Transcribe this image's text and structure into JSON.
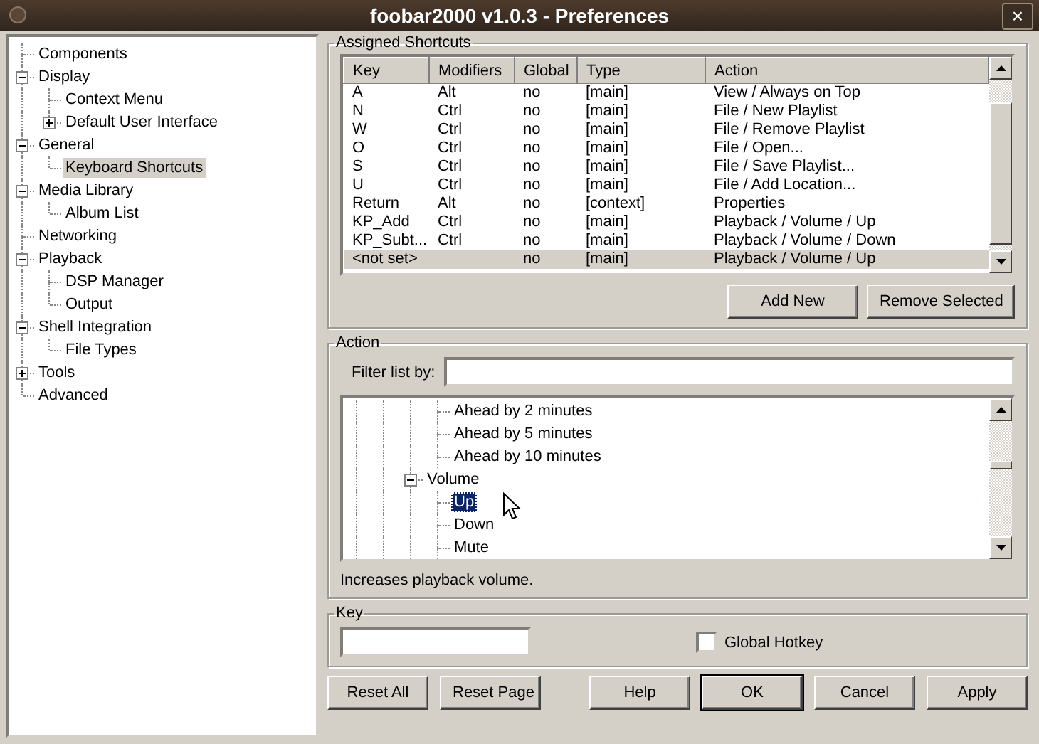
{
  "window": {
    "title": "foobar2000 v1.0.3 - Preferences",
    "close": "×"
  },
  "sidebar": {
    "items": [
      {
        "label": "Components",
        "selected": false
      },
      {
        "label": "Display",
        "selected": false,
        "expanded": true,
        "children": [
          {
            "label": "Context Menu",
            "selected": false
          },
          {
            "label": "Default User Interface",
            "selected": false,
            "expanded": false
          }
        ]
      },
      {
        "label": "General",
        "selected": false,
        "expanded": true,
        "children": [
          {
            "label": "Keyboard Shortcuts",
            "selected": true
          }
        ]
      },
      {
        "label": "Media Library",
        "selected": false,
        "expanded": true,
        "children": [
          {
            "label": "Album List",
            "selected": false
          }
        ]
      },
      {
        "label": "Networking",
        "selected": false
      },
      {
        "label": "Playback",
        "selected": false,
        "expanded": true,
        "children": [
          {
            "label": "DSP Manager",
            "selected": false
          },
          {
            "label": "Output",
            "selected": false
          }
        ]
      },
      {
        "label": "Shell Integration",
        "selected": false,
        "expanded": true,
        "children": [
          {
            "label": "File Types",
            "selected": false
          }
        ]
      },
      {
        "label": "Tools",
        "selected": false,
        "expanded": false
      },
      {
        "label": "Advanced",
        "selected": false
      }
    ]
  },
  "shortcuts": {
    "title": "Assigned Shortcuts",
    "columns": [
      "Key",
      "Modifiers",
      "Global",
      "Type",
      "Action"
    ],
    "rows": [
      {
        "cells": [
          "A",
          "Alt",
          "no",
          "[main]",
          "View / Always on Top"
        ],
        "selected": false
      },
      {
        "cells": [
          "N",
          "Ctrl",
          "no",
          "[main]",
          "File / New Playlist"
        ],
        "selected": false
      },
      {
        "cells": [
          "W",
          "Ctrl",
          "no",
          "[main]",
          "File / Remove Playlist"
        ],
        "selected": false
      },
      {
        "cells": [
          "O",
          "Ctrl",
          "no",
          "[main]",
          "File / Open..."
        ],
        "selected": false
      },
      {
        "cells": [
          "S",
          "Ctrl",
          "no",
          "[main]",
          "File / Save Playlist..."
        ],
        "selected": false
      },
      {
        "cells": [
          "U",
          "Ctrl",
          "no",
          "[main]",
          "File / Add Location..."
        ],
        "selected": false
      },
      {
        "cells": [
          "Return",
          "Alt",
          "no",
          "[context]",
          "Properties"
        ],
        "selected": false
      },
      {
        "cells": [
          "KP_Add",
          "Ctrl",
          "no",
          "[main]",
          "Playback / Volume / Up"
        ],
        "selected": false
      },
      {
        "cells": [
          "KP_Subt...",
          "Ctrl",
          "no",
          "[main]",
          "Playback / Volume / Down"
        ],
        "selected": false
      },
      {
        "cells": [
          "<not set>",
          "",
          "no",
          "[main]",
          "Playback / Volume / Up"
        ],
        "selected": true
      }
    ],
    "buttons": [
      "Add New",
      "Remove Selected"
    ]
  },
  "action": {
    "title": "Action",
    "filter_label": "Filter list by:",
    "tree": [
      {
        "children": [
          {
            "children": [
              {
                "children": [
                  {
                    "label": "Ahead by 2 minutes",
                    "selected": false
                  },
                  {
                    "label": "Ahead by 5 minutes",
                    "selected": false
                  },
                  {
                    "label": "Ahead by 10 minutes",
                    "selected": false
                  }
                ]
              },
              {
                "label": "Volume",
                "selected": false,
                "expanded": true,
                "children": [
                  {
                    "label": "Up",
                    "selected": true
                  },
                  {
                    "label": "Down",
                    "selected": false
                  },
                  {
                    "label": "Mute",
                    "selected": false
                  }
                ]
              }
            ]
          }
        ]
      }
    ],
    "description": "Increases playback volume."
  },
  "key": {
    "title": "Key",
    "global_hotkey": {
      "label": "Global Hotkey",
      "checked": false
    }
  },
  "buttons": [
    {
      "label": "Reset All",
      "default": false
    },
    {
      "label": "Reset Page",
      "default": false
    },
    {
      "label": "Help",
      "default": false
    },
    {
      "label": "OK",
      "default": true
    },
    {
      "label": "Cancel",
      "default": false
    },
    {
      "label": "Apply",
      "default": false
    }
  ]
}
